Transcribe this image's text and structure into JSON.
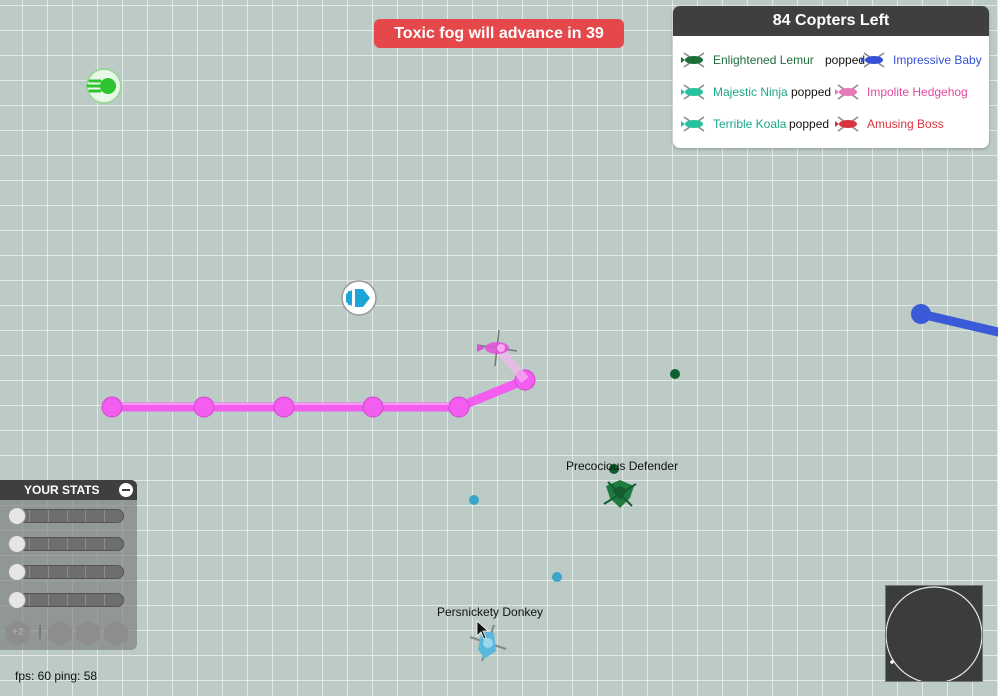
{
  "banner": {
    "text": "Toxic fog will advance in 39"
  },
  "leaderboard": {
    "title": "84 Copters Left",
    "events": [
      {
        "killer": "Enlightened Lemur",
        "killer_color": "#1e6e3c",
        "action": "popped",
        "victim": "Impressive Baby",
        "victim_color": "#3552d6"
      },
      {
        "killer": "Majestic Ninja",
        "killer_color": "#1aa78a",
        "action": "popped",
        "victim": "Impolite Hedgehog",
        "victim_color": "#e04aa0"
      },
      {
        "killer": "Terrible Koala",
        "killer_color": "#1aa78a",
        "action": "popped",
        "victim": "Amusing Boss",
        "victim_color": "#d8343c"
      }
    ]
  },
  "players": {
    "enemy_name": "Precocious Defender",
    "self_name": "Persnickety Donkey"
  },
  "stats_panel": {
    "title": "YOUR STATS",
    "rows": [
      {
        "icon": "speed-icon",
        "level": 0,
        "max": 5
      },
      {
        "icon": "bullet-speed-icon",
        "level": 0,
        "max": 5
      },
      {
        "icon": "spread-icon",
        "level": 0,
        "max": 5
      },
      {
        "icon": "reload-icon",
        "level": 0,
        "max": 5
      }
    ],
    "upgrade_badge": "+2"
  },
  "hud": {
    "fps_text": "fps: 60 ping: 58"
  },
  "colors": {
    "pink": "#f45ef0",
    "blue_trail": "#3b5ad8",
    "green_powerup": "#2fc32f",
    "cyan_powerup": "#1ea5d8",
    "self_copter": "#5bb7dc",
    "enemy_copter": "#1e6e3c"
  }
}
